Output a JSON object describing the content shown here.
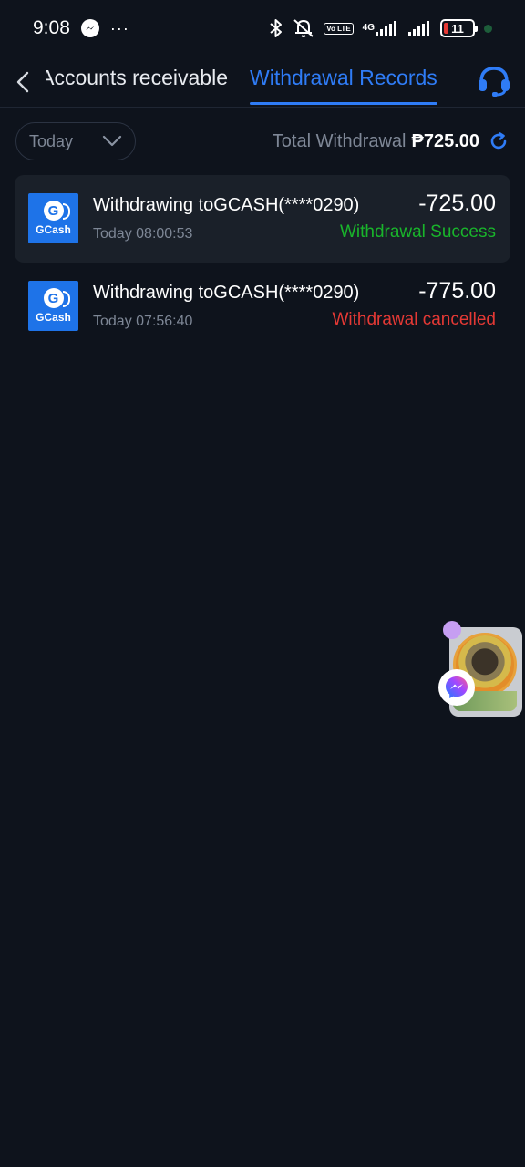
{
  "status_bar": {
    "time": "9:08",
    "dots": "···",
    "lte": "Vo LTE",
    "network": "4G",
    "battery": "11",
    "icons": [
      "messenger-icon",
      "bluetooth-icon",
      "muted-bell-icon",
      "signal-icon",
      "battery-icon"
    ]
  },
  "nav": {
    "back_icon": "chevron-left-icon",
    "tab_inactive": "Accounts receivable",
    "tab_active": "Withdrawal Records",
    "support_icon": "headset-icon"
  },
  "filter": {
    "date_value": "Today",
    "total_label": "Total Withdrawal",
    "total_value": "₱725.00",
    "refresh_icon": "refresh-icon"
  },
  "records": [
    {
      "title": "Withdrawing toGCASH(****0290)",
      "time": "Today 08:00:53",
      "amount": "-725.00",
      "status": "Withdrawal Success",
      "logo": "GCash"
    },
    {
      "title": "Withdrawing toGCASH(****0290)",
      "time": "Today 07:56:40",
      "amount": "-775.00",
      "status": "Withdrawal cancelled",
      "logo": "GCash"
    }
  ],
  "colors": {
    "background": "#0e131c",
    "accent": "#2f7cf6",
    "success": "#19b52b",
    "cancelled": "#e53935",
    "muted": "#7e8796"
  }
}
